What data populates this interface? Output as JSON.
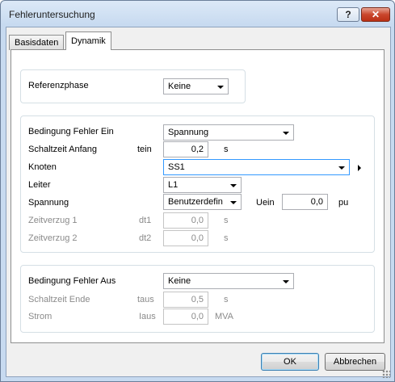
{
  "window": {
    "title": "Fehleruntersuchung",
    "help": "?",
    "close": "✕"
  },
  "tabs": [
    {
      "label": "Basisdaten"
    },
    {
      "label": "Dynamik"
    }
  ],
  "ref": {
    "label": "Referenzphase",
    "value": "Keine"
  },
  "fault_on": {
    "condition_label": "Bedingung Fehler Ein",
    "condition_value": "Spannung",
    "switch_label": "Schaltzeit Anfang",
    "switch_sym": "tein",
    "switch_value": "0,2",
    "switch_unit": "s",
    "node_label": "Knoten",
    "node_value": "SS1",
    "conductor_label": "Leiter",
    "conductor_value": "L1",
    "voltage_label": "Spannung",
    "voltage_value": "Benutzerdefin",
    "u_sym": "Uein",
    "u_value": "0,0",
    "u_unit": "pu",
    "delay1_label": "Zeitverzug 1",
    "delay1_sym": "dt1",
    "delay1_value": "0,0",
    "delay1_unit": "s",
    "delay2_label": "Zeitverzug 2",
    "delay2_sym": "dt2",
    "delay2_value": "0,0",
    "delay2_unit": "s"
  },
  "fault_off": {
    "condition_label": "Bedingung Fehler Aus",
    "condition_value": "Keine",
    "end_label": "Schaltzeit Ende",
    "end_sym": "taus",
    "end_value": "0,5",
    "end_unit": "s",
    "current_label": "Strom",
    "current_sym": "Iaus",
    "current_value": "0,0",
    "current_unit": "MVA"
  },
  "buttons": {
    "ok": "OK",
    "cancel": "Abbrechen"
  }
}
